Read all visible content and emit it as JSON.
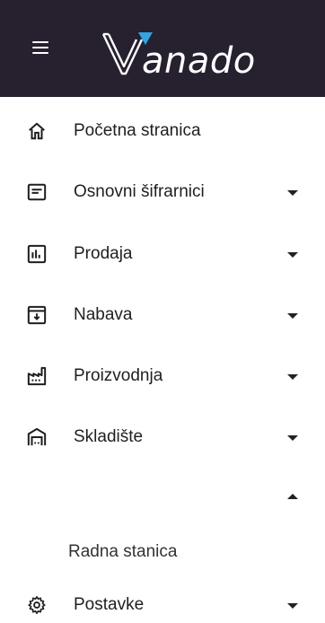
{
  "header": {
    "brand_text": "anado",
    "brand_accent_color": "#2aa7e6",
    "background_color": "#26202f"
  },
  "nav": {
    "items": [
      {
        "label": "Početna stranica",
        "icon": "home-icon"
      },
      {
        "label": "Osnovni šifrarnici",
        "icon": "document-icon"
      },
      {
        "label": "Prodaja",
        "icon": "bar-chart-icon"
      },
      {
        "label": "Nabava",
        "icon": "archive-icon"
      },
      {
        "label": "Proizvodnja",
        "icon": "factory-icon"
      },
      {
        "label": "Skladište",
        "icon": "warehouse-icon"
      },
      {
        "label": "",
        "icon": ""
      },
      {
        "label": "Postavke",
        "icon": "gear-icon"
      }
    ],
    "sub_item": {
      "label": "Radna stanica"
    }
  }
}
